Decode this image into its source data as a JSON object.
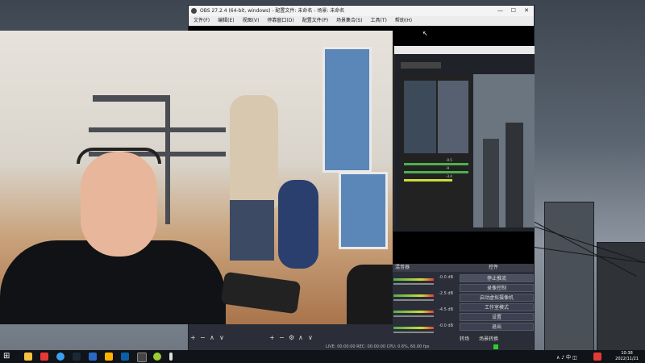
{
  "obs": {
    "title": "OBS 27.2.4 (64-bit, windows) - 配置文件: 未命名 - 场景: 未命名",
    "menu": [
      "文件(F)",
      "编辑(E)",
      "视图(V)",
      "停靠窗口(D)",
      "配置文件(P)",
      "场景集合(S)",
      "工具(T)",
      "帮助(H)"
    ],
    "dock_left": "混音器",
    "dock_right": "控件",
    "controls": [
      "停止推流",
      "录像控制",
      "启动虚拟摄像机",
      "工作室模式",
      "设置",
      "退出"
    ],
    "mixer_values": [
      "-0.0 dB",
      "-2.5 dB",
      "-4.5 dB",
      "-0.0 dB"
    ],
    "nested_values": [
      "-0.5",
      "-9",
      "-3.4"
    ],
    "toolbar": [
      "+",
      "−",
      "∧",
      "∨",
      "⚙"
    ],
    "status": "LIVE: 00:00:00   REC: 00:00:00   CPU: 0.6%, 60.00 fps",
    "tab_left": "转场",
    "tab_right": "场景转换",
    "pointer": "↖"
  },
  "taskbar": {
    "time": "10:38",
    "date": "2022/11/21",
    "system_tray": "∧ ♪ 中 ◫"
  },
  "colors": {
    "accent": "#5b86b8",
    "obs_bg": "#2b2e38"
  }
}
